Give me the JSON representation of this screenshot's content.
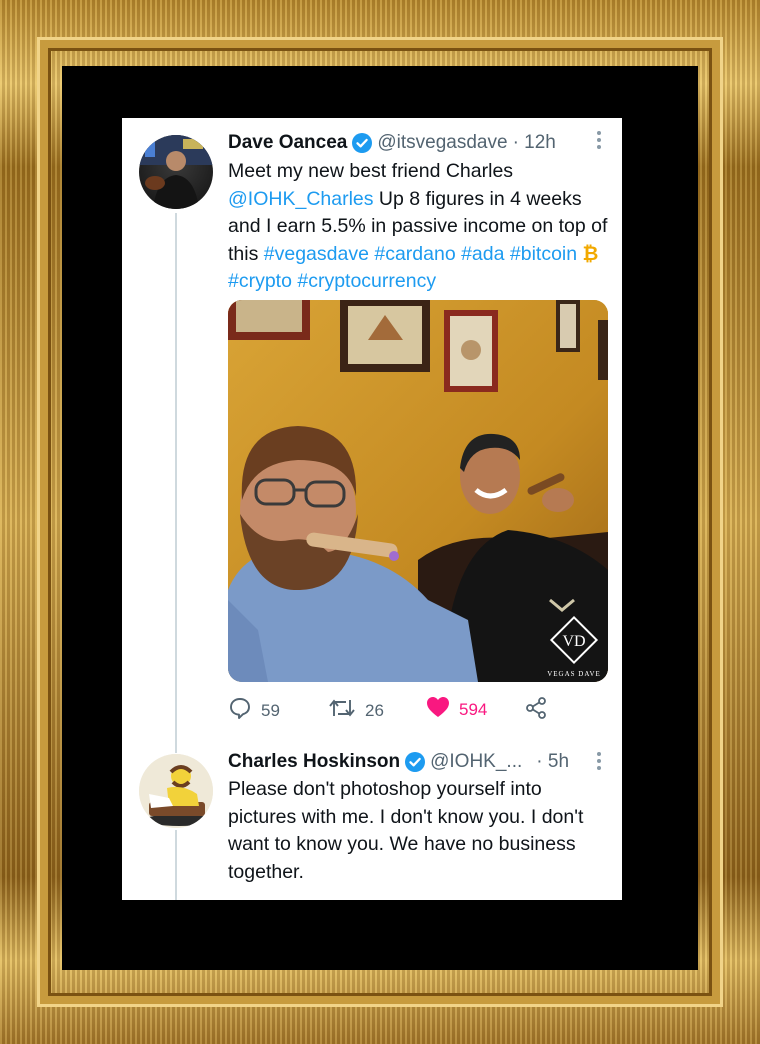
{
  "tweet1": {
    "name": "Dave Oancea",
    "handle": "@itsvegasdave",
    "time": "· 12h",
    "text_a": "Meet my new best friend Charles",
    "mention": "@IOHK_Charles",
    "text_b": " Up 8 figures in 4 weeks and I earn 5.5% in passive income on top of this ",
    "tags_a": "#vegasdave #cardano #ada",
    "tag_btc": "#bitcoin",
    "btc_symbol": "₿",
    "tags_b": "#crypto #cryptocurrency",
    "watermark": "VEGAS DAVE",
    "replies": "59",
    "retweets": "26",
    "likes": "594"
  },
  "tweet2": {
    "name": "Charles Hoskinson",
    "handle": "@IOHK_...",
    "time": "· 5h",
    "text": "Please don't photoshop yourself into pictures with me. I don't know you. I don't want to know you. We have no business together."
  },
  "colors": {
    "link": "#1d9bf0",
    "like": "#f91880",
    "verified": "#1d9bf0",
    "muted": "#536471"
  },
  "icons": [
    "verified-badge-icon",
    "more-icon",
    "reply-icon",
    "retweet-icon",
    "heart-icon",
    "share-icon"
  ]
}
